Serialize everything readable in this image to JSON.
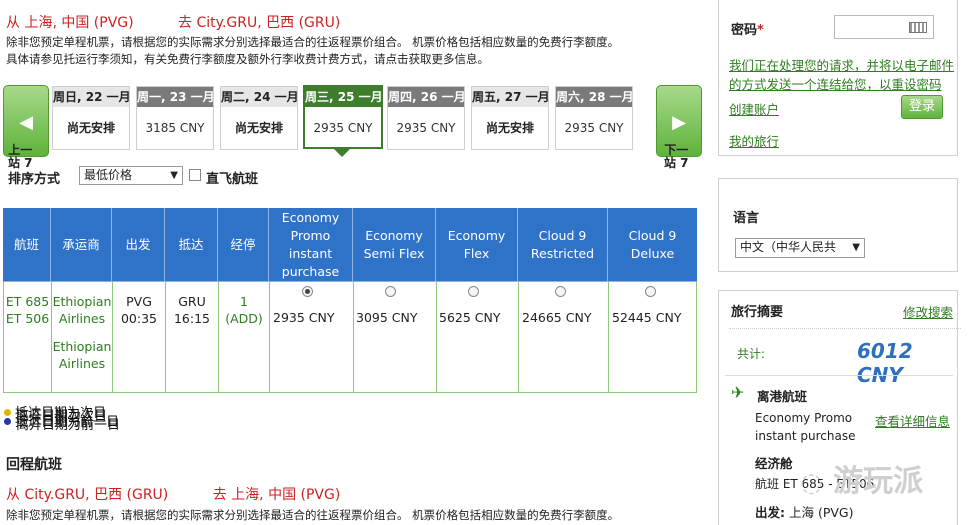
{
  "outbound": {
    "from": "从 上海, 中国 (PVG)",
    "to": "去 City.GRU, 巴西 (GRU)",
    "note_line1": "除非您预定单程机票，请根据您的实际需求分别选择最适合的往返程票价组合。 机票价格包括相应数量的免费行李额度。",
    "note_line2": "具体请参见托运行李须知，有关免费行李额度及额外行李收费计费方式，请点击获取更多信息。"
  },
  "date_nav": {
    "prev_label_1": "上一",
    "prev_label_2": "站 7",
    "next_label_1": "下一",
    "next_label_2": "站 7",
    "prev_arrow": "◀",
    "next_arrow": "▶",
    "dates": [
      {
        "day": "周日, 22 一月",
        "price": "尚无安排"
      },
      {
        "day": "周一, 23 一月",
        "price": "3185 CNY"
      },
      {
        "day": "周二, 24 一月",
        "price": "尚无安排"
      },
      {
        "day": "周三, 25 一月",
        "price": "2935 CNY"
      },
      {
        "day": "周四, 26 一月",
        "price": "2935 CNY"
      },
      {
        "day": "周五, 27 一月",
        "price": "尚无安排"
      },
      {
        "day": "周六, 28 一月",
        "price": "2935 CNY"
      }
    ]
  },
  "sort": {
    "label": "排序方式",
    "value": "最低价格",
    "nonstop_label": "直飞航班"
  },
  "table": {
    "headers": [
      "航班",
      "承运商",
      "出发",
      "抵达",
      "经停"
    ],
    "fare_headers": [
      [
        "Economy",
        "Promo",
        "instant",
        "purchase"
      ],
      [
        "Economy",
        "Semi Flex"
      ],
      [
        "Economy",
        "Flex"
      ],
      [
        "Cloud 9",
        "Restricted"
      ],
      [
        "Cloud 9",
        "Deluxe"
      ]
    ],
    "row": {
      "flights": [
        "ET 685",
        "ET 506"
      ],
      "carriers": [
        "Ethiopian",
        "Airlines",
        "Ethiopian",
        "Airlines"
      ],
      "depart": [
        "PVG",
        "00:35"
      ],
      "arrive": [
        "GRU",
        "16:15"
      ],
      "stops": [
        "1",
        "(ADD)"
      ],
      "prices": [
        "2935 CNY",
        "3095 CNY",
        "5625 CNY",
        "24665 CNY",
        "52445 CNY"
      ]
    }
  },
  "legend": {
    "line1": "抵达日期为次日",
    "line2": "抵达日期为前一日",
    "overlay1": "离开日期为次日",
    "overlay2": "离开日期为前一日"
  },
  "return_section": {
    "title": "回程航班",
    "from": "从 City.GRU, 巴西 (GRU)",
    "to": "去 上海, 中国 (PVG)",
    "note_line1": "除非您预定单程机票，请根据您的实际需求分别选择最适合的往返程票价组合。 机票价格包括相应数量的免费行李额度。"
  },
  "login": {
    "password_label": "密码",
    "required_mark": "*",
    "forgot_1": "我们正在处理您的请求，并将以电子邮件",
    "forgot_2": "的方式发送一个连结给您，以重设密码",
    "login_button": "登录",
    "create_account": "创建账户",
    "my_trips": "我的旅行"
  },
  "language": {
    "label": "语言",
    "value": "中文（中华人民共"
  },
  "summary": {
    "title": "旅行摘要",
    "edit_search": "修改搜索",
    "total_label": "共计:",
    "total_value": "6012 CNY",
    "depart_label": "离港航班",
    "fare_1": "Economy Promo",
    "fare_2": "instant purchase",
    "details_link": "查看详细信息",
    "cabin": "经济舱",
    "flight_line": "航班 ET 685 - ET506",
    "origin_label": "出发:",
    "origin_value": "上海 (PVG)"
  },
  "watermark": "游玩派"
}
